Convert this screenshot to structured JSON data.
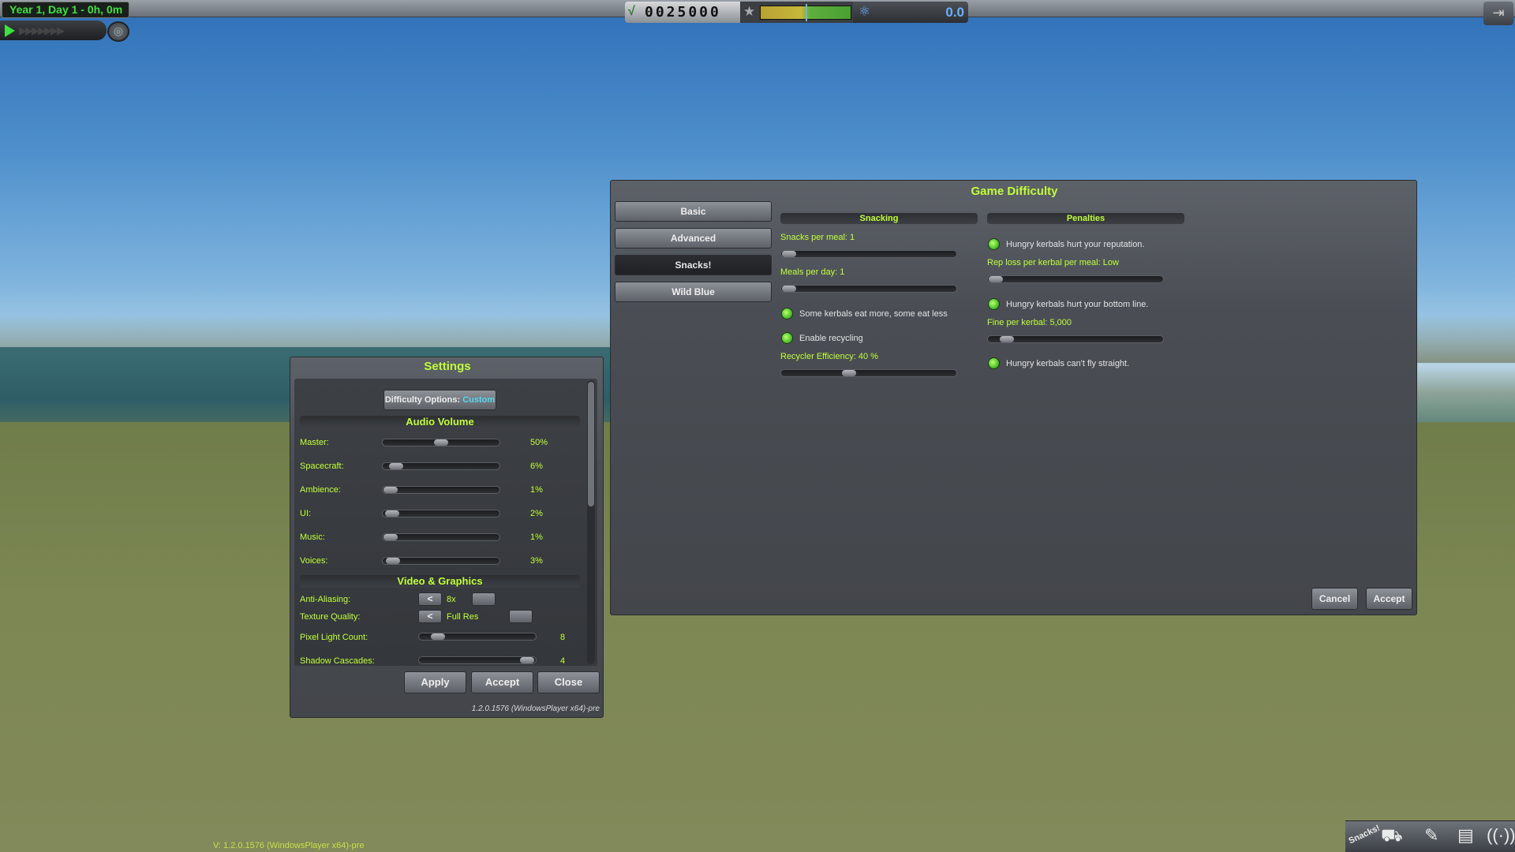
{
  "hud": {
    "date": "Year 1, Day 1 - 0h, 0m",
    "funds": "0025000",
    "science": "0.0"
  },
  "settings": {
    "title": "Settings",
    "difficulty_label": "Difficulty Options:",
    "difficulty_value": "Custom",
    "audio_header": "Audio Volume",
    "audio": [
      {
        "label": "Master:",
        "value": "50%",
        "level": 0.5
      },
      {
        "label": "Spacecraft:",
        "value": "6%",
        "level": 0.06
      },
      {
        "label": "Ambience:",
        "value": "1%",
        "level": 0.01
      },
      {
        "label": "UI:",
        "value": "2%",
        "level": 0.02
      },
      {
        "label": "Music:",
        "value": "1%",
        "level": 0.01
      },
      {
        "label": "Voices:",
        "value": "3%",
        "level": 0.03
      }
    ],
    "video_header": "Video & Graphics",
    "anti_aliasing": {
      "label": "Anti-Aliasing:",
      "value": "8x"
    },
    "texture_quality": {
      "label": "Texture Quality:",
      "value": "Full Res"
    },
    "pixel_light": {
      "label": "Pixel Light Count:",
      "value": "8"
    },
    "shadow_cascades": {
      "label": "Shadow Cascades:",
      "value": "4"
    },
    "apply": "Apply",
    "accept": "Accept",
    "close": "Close",
    "build": "1.2.0.1576 (WindowsPlayer x64)-pre"
  },
  "difficulty": {
    "title": "Game Difficulty",
    "tabs": [
      "Basic",
      "Advanced",
      "Snacks!",
      "Wild Blue"
    ],
    "snacking_header": "Snacking",
    "penalties_header": "Penalties",
    "snacks_per_meal": "Snacks per meal: 1",
    "meals_per_day": "Meals per day: 1",
    "eat_more": "Some kerbals eat more, some eat less",
    "enable_recycling": "Enable recycling",
    "recycler_efficiency": "Recycler Efficiency: 40 %",
    "hurt_reputation": "Hungry kerbals hurt your reputation.",
    "rep_loss": "Rep loss per kerbal per meal: Low",
    "hurt_bottom_line": "Hungry kerbals hurt your bottom line.",
    "fine": "Fine per kerbal: 5,000",
    "cant_fly": "Hungry kerbals can't fly straight.",
    "cancel": "Cancel",
    "accept": "Accept"
  },
  "footer": {
    "version": "V: 1.2.0.1576 (WindowsPlayer x64)-pre",
    "tray_snacks": "Snacks!"
  }
}
